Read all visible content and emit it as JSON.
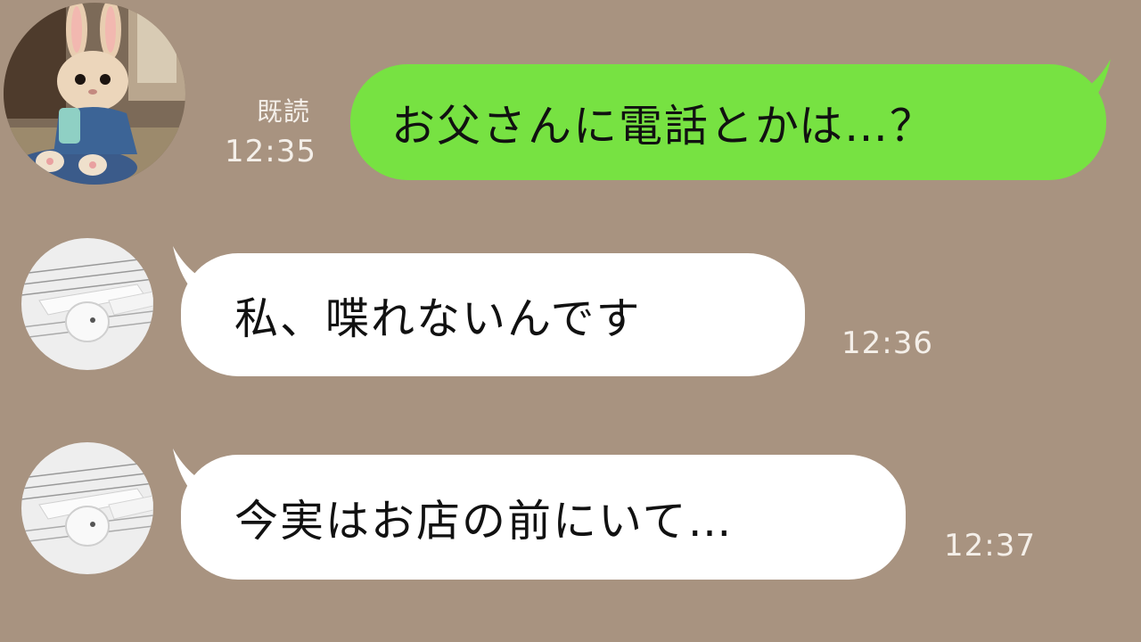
{
  "messages": [
    {
      "direction": "outgoing",
      "text": "お父さんに電話とかは…？",
      "read_label": "既読",
      "time": "12:35",
      "avatar": "rabbit-with-smartphone-avatar"
    },
    {
      "direction": "incoming",
      "text": "私、喋れないんです",
      "time": "12:36",
      "avatar": "earbuds-avatar"
    },
    {
      "direction": "incoming",
      "text": "今実はお店の前にいて…",
      "time": "12:37",
      "avatar": "earbuds-avatar"
    }
  ],
  "colors": {
    "background": "#a89380",
    "outgoing_bubble": "#77e242",
    "incoming_bubble": "#ffffff",
    "meta_text": "#f4efe9"
  }
}
